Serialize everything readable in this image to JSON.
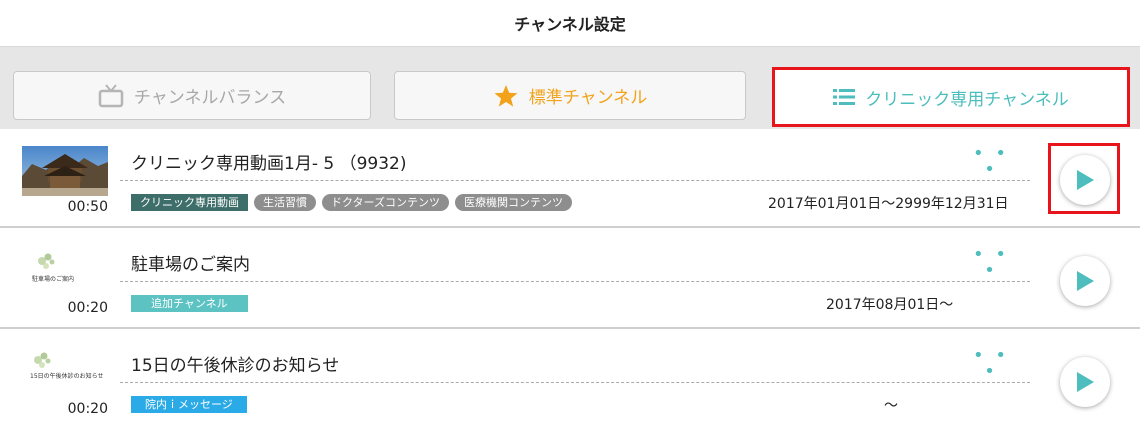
{
  "header": {
    "title": "チャンネル設定"
  },
  "tabs": [
    {
      "label": "チャンネルバランス",
      "icon": "tv-icon",
      "color": "#a8a8a8"
    },
    {
      "label": "標準チャンネル",
      "icon": "star-icon",
      "color": "#f2a31b"
    },
    {
      "label": "クリニック専用チャンネル",
      "icon": "list-icon",
      "color": "#4dbdbd",
      "selected": true
    }
  ],
  "rows": [
    {
      "title": "クリニック専用動画1月- 5 （9932)",
      "duration": "00:50",
      "thumb_caption": "",
      "tags": [
        {
          "label": "クリニック専用動画",
          "color": "#3e6e6a",
          "shape": "rect"
        },
        {
          "label": "生活習慣",
          "color": "#8e8e8e",
          "shape": "pill"
        },
        {
          "label": "ドクターズコンテンツ",
          "color": "#8e8e8e",
          "shape": "pill"
        },
        {
          "label": "医療機関コンテンツ",
          "color": "#8e8e8e",
          "shape": "pill"
        }
      ],
      "date": "2017年01月01日〜2999年12月31日",
      "more": "• • •"
    },
    {
      "title": "駐車場のご案内",
      "duration": "00:20",
      "thumb_caption": "駐車場のご案内",
      "tags": [
        {
          "label": "追加チャンネル",
          "color": "#5cc2c2",
          "shape": "rect"
        }
      ],
      "date": "2017年08月01日〜",
      "more": "• • •"
    },
    {
      "title": "15日の午後休診のお知らせ",
      "duration": "00:20",
      "thumb_caption": "15日の午後休診のお知らせ",
      "tags": [
        {
          "label": "院内ｉメッセージ",
          "color": "#2aaae6",
          "shape": "rect"
        }
      ],
      "date": "〜",
      "more": "• • •"
    }
  ]
}
